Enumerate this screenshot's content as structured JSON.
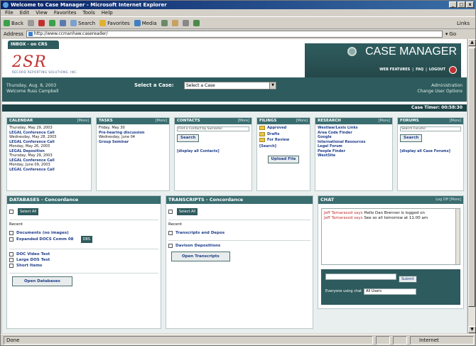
{
  "window": {
    "title": "Welcome to Case Manager - Microsoft Internet Explorer",
    "min": "_",
    "max": "□",
    "close": "x"
  },
  "menu": [
    "File",
    "Edit",
    "View",
    "Favorites",
    "Tools",
    "Help"
  ],
  "toolbar": {
    "back": "Back",
    "search": "Search",
    "favorites": "Favorites",
    "media": "Media",
    "links": "Links"
  },
  "address": {
    "label": "Address",
    "url": "http://www.ccmanhaw.casereader/",
    "go": "Go"
  },
  "logo": {
    "text": "2SR",
    "sub": "RECORD REPORTING SOLUTIONS, INC."
  },
  "brand": {
    "title": "CASE MANAGER",
    "nav": [
      "WEB FEATURES",
      "FAQ",
      "LOGOUT"
    ]
  },
  "band": {
    "date1": "Thursday, Aug. 8, 2003",
    "date2": "Welcome Russ Campbell",
    "select_label": "Select a Case:",
    "select_value": "Select a Case",
    "admin1": "Administration",
    "admin2": "Change User Options"
  },
  "tab": {
    "label": "INBOX - on CRS"
  },
  "timer": {
    "label": "Case Timer: 00:58:30"
  },
  "calendar": {
    "title": "CALENDAR",
    "more": "[More]",
    "items": [
      {
        "d": "Thursday, May 29, 2003",
        "t": "LEGAL  Conference Call"
      },
      {
        "d": "Wednesday, May 28, 2003",
        "t": "LEGAL  Conference Call"
      },
      {
        "d": "Monday, May 26, 2003",
        "t": "LEGAL  Deposition"
      },
      {
        "d": "Thursday, May 29, 2003",
        "t": "LEGAL  Conference Call"
      },
      {
        "d": "Monday, June 09, 2003",
        "t": "LEGAL  Conference Call"
      }
    ]
  },
  "tasks": {
    "title": "TASKS",
    "more": "[More]",
    "lines": [
      "Friday, May 30",
      "Pre-hearing discussion",
      "Wednesday, June 04",
      "Group Seminar"
    ]
  },
  "contacts": {
    "title": "CONTACTS",
    "more": "[More]",
    "placeholder": "Find a Contact by Surname:",
    "search": "Search",
    "all": "[display all Contacts]"
  },
  "filings": {
    "title": "FILINGS",
    "more": "[More]",
    "folders": [
      "Approved",
      "Drafts",
      "For Review",
      "[Search]"
    ],
    "upload": "Upload File"
  },
  "research": {
    "title": "RESEARCH",
    "more": "[More]",
    "items": [
      "Westlaw/Lexis Links",
      "Area Code Finder",
      "Google",
      "International Resources",
      "Legal Forum",
      "People Finder",
      "WestSite"
    ]
  },
  "forums": {
    "title": "FORUMS",
    "more": "[More]",
    "placeholder": "Search Forums:",
    "search": "Search",
    "all": "[display all Case Forums]"
  },
  "databases": {
    "title": "DATABASES - Concordance",
    "select_all": "Select All",
    "recent": "Recent",
    "docs": "Documents (no images)",
    "expanded": "Expanded DOCS Comm 08",
    "db_tag": "DBS",
    "video": "DOC Video Test",
    "large": "Large DOS Test",
    "short": "Short Items",
    "open": "Open Databases"
  },
  "transcripts": {
    "title": "TRANSCRIPTS - Concordance",
    "select_all": "Select All",
    "recent": "Recent",
    "t1": "Transcripts and Depos",
    "t2": "Davison Depositions",
    "open": "Open Transcripts"
  },
  "chat": {
    "title": "CHAT",
    "links": "Log Off  [More]",
    "m1_user": "Jeff Tamarasod says",
    "m1_text": "Hello Dan Brenner is logged on",
    "m2_user": "Jeff Tamarasod says",
    "m2_text": "See so all tomorrow at 11:00 am",
    "submit": "Submit",
    "who_label": "Everyone using chat",
    "who_value": "All Users"
  },
  "status": {
    "left": "Done",
    "zone": "Internet"
  }
}
